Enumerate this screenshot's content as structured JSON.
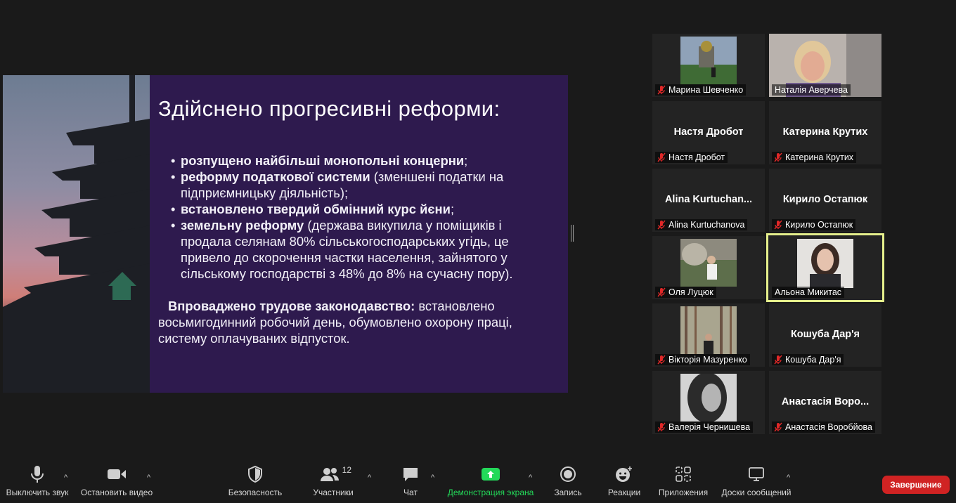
{
  "slide": {
    "title": "Здійснено прогресивні реформи:",
    "bullets": [
      {
        "bold": "розпущено найбільші монопольні концерни",
        "rest": ";"
      },
      {
        "bold": "реформу податкової системи",
        "rest": " (зменшені податки на підприємницьку діяльність);"
      },
      {
        "bold": " встановлено твердий обмінний курс йєни",
        "rest": ";"
      },
      {
        "bold": "земельну реформу",
        "rest": " (держава викупила у поміщиків і продала селянам 80% сільськогосподарських угідь, це привело до скорочення частки населення, зайнятого у сільському господарстві з 48% до 8% на сучасну пору)."
      }
    ],
    "para_bold": "Впроваджено трудове законодавство:",
    "para_rest": " встановлено восьмигодинний робочий день, обумовлено охорону праці, систему оплачуваних відпусток."
  },
  "participants": [
    {
      "label": "Марина Шевченко",
      "video": true
    },
    {
      "label": "Наталія Аверчева",
      "video": true
    },
    {
      "name": "Настя Дробот",
      "label": "Настя Дробот",
      "video": false
    },
    {
      "name": "Катерина Крутих",
      "label": "Катерина Крутих",
      "video": false
    },
    {
      "name": "Alina  Kurtuchan...",
      "label": "Alina Kurtuchanova",
      "video": false
    },
    {
      "name": "Кирило Остапюк",
      "label": "Кирило Остапюк",
      "video": false
    },
    {
      "label": "Оля Луцюк",
      "video": true
    },
    {
      "label": "Альона Микитас",
      "video": true,
      "speaking": true
    },
    {
      "label": "Вікторія Мазуренко",
      "video": true
    },
    {
      "name": "Кошуба Дар'я",
      "label": "Кошуба Дар'я",
      "video": false
    },
    {
      "label": "Валерія Чернишева",
      "video": true
    },
    {
      "name": "Анастасія Воро...",
      "label": "Анастасія Воробйова",
      "video": false
    }
  ],
  "toolbar": {
    "mute": "Выключить звук",
    "video": "Остановить видео",
    "security": "Безопасность",
    "participants": "Участники",
    "participants_count": "12",
    "chat": "Чат",
    "share": "Демонстрация экрана",
    "record": "Запись",
    "reactions": "Реакции",
    "apps": "Приложения",
    "whiteboards": "Доски сообщений",
    "end": "Завершение"
  },
  "colors": {
    "slide_bg": "#2e1a4e",
    "speaker_outline": "#e5ef8c",
    "share_green": "#23d959",
    "end_red": "#d02323"
  }
}
